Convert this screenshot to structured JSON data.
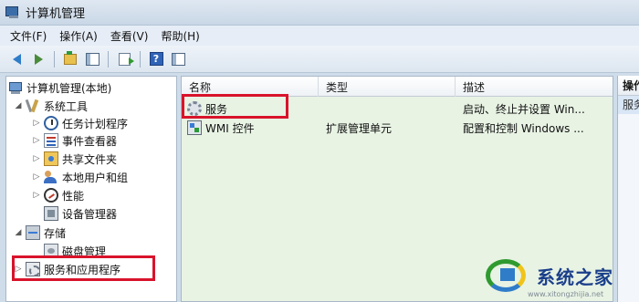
{
  "window": {
    "title": "计算机管理"
  },
  "menu": [
    "文件(F)",
    "操作(A)",
    "查看(V)",
    "帮助(H)"
  ],
  "toolbar": {
    "icons": [
      "back-arrow-icon",
      "forward-arrow-icon",
      "up-folder-icon",
      "show-hide-tree-icon",
      "export-list-icon",
      "help-icon",
      "show-hide-action-pane-icon"
    ]
  },
  "tree": {
    "root": "计算机管理(本地)",
    "items": [
      {
        "label": "系统工具"
      },
      {
        "label": "任务计划程序"
      },
      {
        "label": "事件查看器"
      },
      {
        "label": "共享文件夹"
      },
      {
        "label": "本地用户和组"
      },
      {
        "label": "性能"
      },
      {
        "label": "设备管理器"
      },
      {
        "label": "存储"
      },
      {
        "label": "磁盘管理"
      },
      {
        "label": "服务和应用程序"
      }
    ]
  },
  "list": {
    "columns": [
      "名称",
      "类型",
      "描述"
    ],
    "rows": [
      {
        "name": "服务",
        "type": "",
        "description": "启动、终止并设置 Win..."
      },
      {
        "name": "WMI 控件",
        "type": "扩展管理单元",
        "description": "配置和控制 Windows ..."
      }
    ]
  },
  "actions": {
    "header": "操作",
    "item": "服务"
  },
  "watermark": {
    "text": "系统之家",
    "url": "www.xitongzhijia.net"
  },
  "colors": {
    "highlight": "#d9132b",
    "list_background": "#e8f3e4"
  }
}
